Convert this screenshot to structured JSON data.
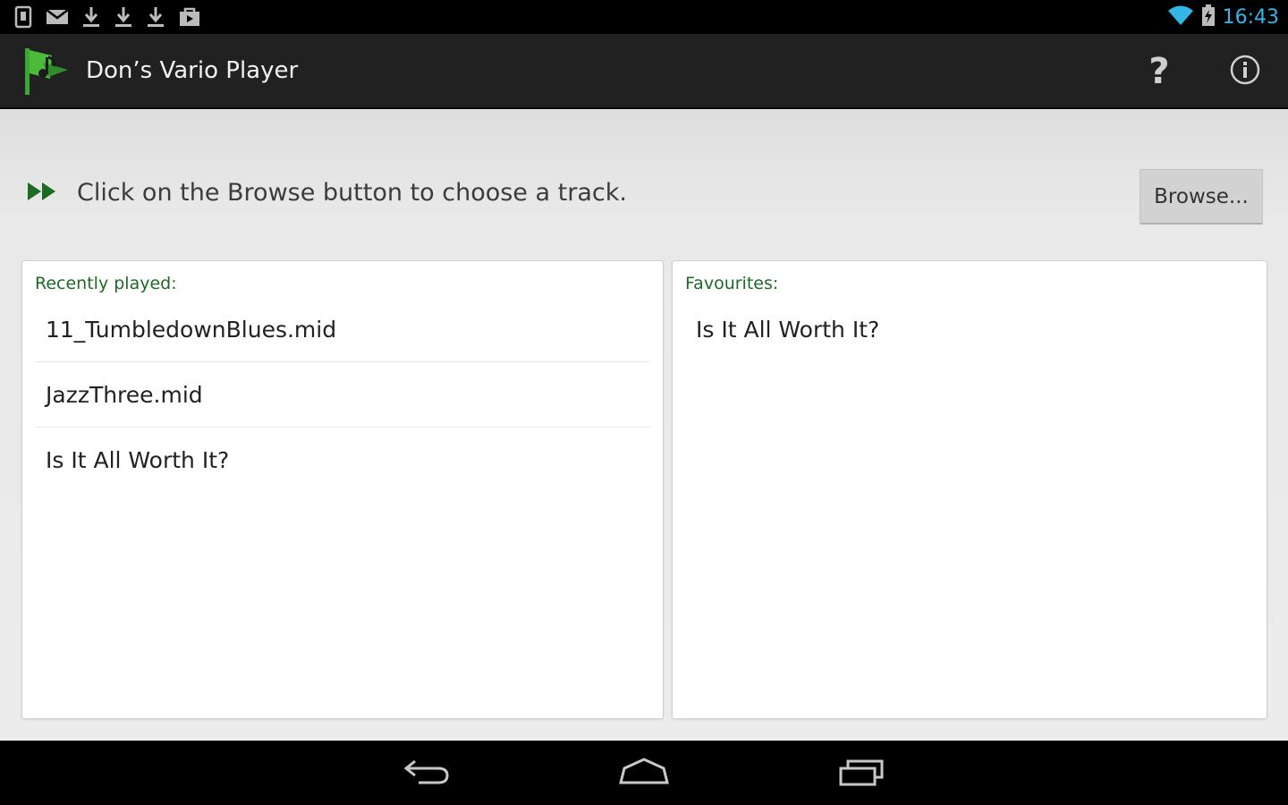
{
  "status_bar": {
    "time": "16:43",
    "notification_icons": [
      "sim-icon",
      "gmail-icon",
      "download-icon",
      "download-icon",
      "download-icon",
      "store-icon"
    ],
    "system_icons": [
      "wifi-icon",
      "battery-icon"
    ]
  },
  "action_bar": {
    "title": "Don’s Vario Player",
    "help_label": "?",
    "logo_icon": "flag-logo-icon"
  },
  "prompt": {
    "text": "Click on the Browse button to choose a track.",
    "icon": "fast-forward-icon"
  },
  "browse_button": {
    "label": "Browse..."
  },
  "recently_played": {
    "header": "Recently played:",
    "items": [
      {
        "label": "11_TumbledownBlues.mid"
      },
      {
        "label": "JazzThree.mid"
      },
      {
        "label": "Is It All Worth It?"
      }
    ]
  },
  "favourites": {
    "header": "Favourites:",
    "items": [
      {
        "label": "Is It All Worth It?"
      }
    ]
  },
  "colors": {
    "accent_green": "#1c6b22",
    "clock_blue": "#33b5e5",
    "action_bar_bg": "#212121"
  }
}
